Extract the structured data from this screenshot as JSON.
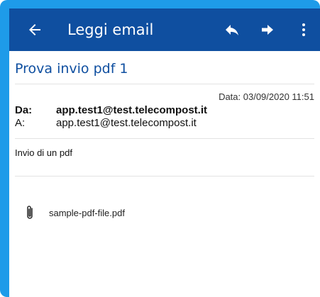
{
  "appbar": {
    "title": "Leggi email",
    "back_icon": "arrow-left-icon",
    "reply_icon": "reply-icon",
    "forward_icon": "forward-arrow-icon",
    "menu_icon": "more-vertical-icon",
    "color": "#0f4fa0"
  },
  "email": {
    "subject": "Prova invio pdf 1",
    "date": "Data: 03/09/2020 11:51",
    "from_label": "Da:",
    "from": "app.test1@test.telecompost.it",
    "to_label": "A:",
    "to": "app.test1@test.telecompost.it",
    "body": "Invio di un pdf"
  },
  "attachments": [
    {
      "icon": "paperclip-icon",
      "filename": "sample-pdf-file.pdf"
    }
  ],
  "colors": {
    "frame": "#1e9be9",
    "accent": "#0f4fa0"
  }
}
